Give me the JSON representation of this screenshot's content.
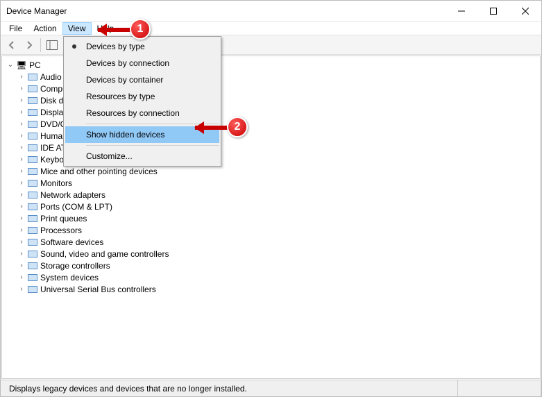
{
  "window": {
    "title": "Device Manager"
  },
  "menubar": {
    "file": "File",
    "action": "Action",
    "view": "View",
    "help": "Help"
  },
  "dropdown": {
    "devices_by_type": "Devices by type",
    "devices_by_connection": "Devices by connection",
    "devices_by_container": "Devices by container",
    "resources_by_type": "Resources by type",
    "resources_by_connection": "Resources by connection",
    "show_hidden": "Show hidden devices",
    "customize": "Customize..."
  },
  "tree": {
    "root": "PC",
    "items": [
      "Audio inputs and outputs",
      "Computer",
      "Disk drives",
      "Display adapters",
      "DVD/CD-ROM drives",
      "Human Interface Devices",
      "IDE ATA/ATAPI controllers",
      "Keyboards",
      "Mice and other pointing devices",
      "Monitors",
      "Network adapters",
      "Ports (COM & LPT)",
      "Print queues",
      "Processors",
      "Software devices",
      "Sound, video and game controllers",
      "Storage controllers",
      "System devices",
      "Universal Serial Bus controllers"
    ]
  },
  "status": {
    "text": "Displays legacy devices and devices that are no longer installed."
  },
  "annotations": {
    "badge1": "1",
    "badge2": "2"
  }
}
